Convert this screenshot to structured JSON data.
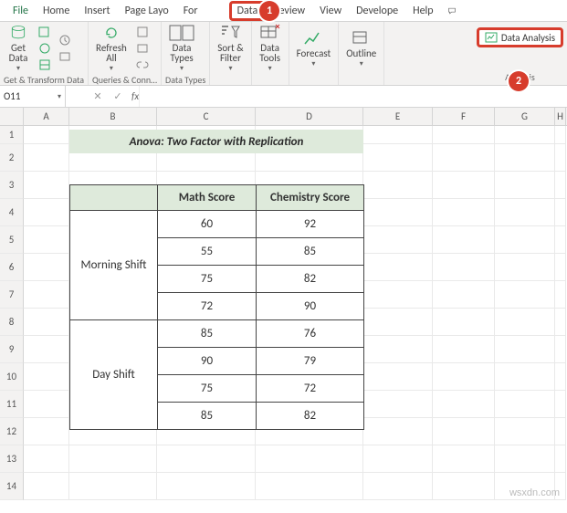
{
  "tabs": {
    "file": "File",
    "home": "Home",
    "insert": "Insert",
    "pagelayout": "Page Layo",
    "formulas": "For",
    "data": "Data",
    "review": "Review",
    "view": "View",
    "developer": "Develope",
    "help": "Help"
  },
  "callouts": {
    "one": "1",
    "two": "2"
  },
  "ribbon": {
    "getdata": "Get\nData",
    "refresh": "Refresh\nAll",
    "datatypes": "Data\nTypes",
    "sort": "Sort &\nFilter",
    "datatools": "Data\nTools",
    "forecast": "Forecast",
    "outline": "Outline",
    "data_analysis": "Data Analysis",
    "grp_get": "Get & Transform Data",
    "grp_queries": "Queries & Conn…",
    "grp_types": "Data Types",
    "grp_analysis": "Analysis"
  },
  "namebox": "O11",
  "fx": "fx",
  "cols": [
    "A",
    "B",
    "C",
    "D",
    "E",
    "F",
    "G",
    "H"
  ],
  "rows": [
    "1",
    "2",
    "3",
    "4",
    "5",
    "6",
    "7",
    "8",
    "9",
    "10",
    "11",
    "12",
    "13",
    "14"
  ],
  "title": "Anova: Two Factor with Replication",
  "headers": {
    "b": "",
    "c": "Math Score",
    "d": "Chemistry Score"
  },
  "shift1": "Morning Shift",
  "shift2": "Day Shift",
  "data": {
    "r1": {
      "c": "60",
      "d": "92"
    },
    "r2": {
      "c": "55",
      "d": "85"
    },
    "r3": {
      "c": "75",
      "d": "82"
    },
    "r4": {
      "c": "72",
      "d": "90"
    },
    "r5": {
      "c": "85",
      "d": "76"
    },
    "r6": {
      "c": "90",
      "d": "79"
    },
    "r7": {
      "c": "75",
      "d": "72"
    },
    "r8": {
      "c": "85",
      "d": "82"
    }
  },
  "watermark": "wsxdn.com"
}
